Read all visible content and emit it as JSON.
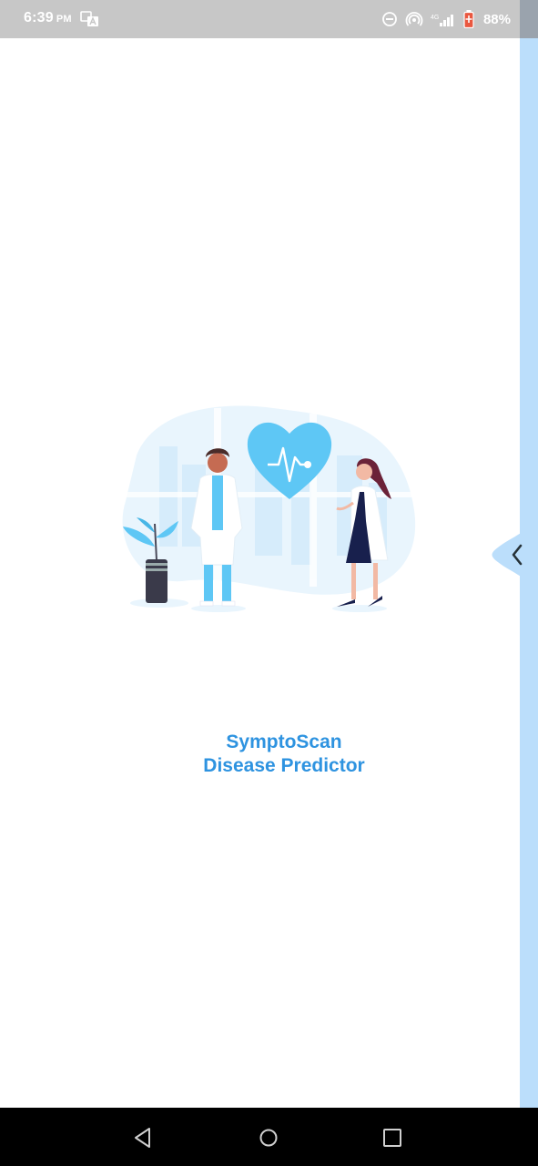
{
  "status_bar": {
    "time": "6:39",
    "ampm": "PM",
    "battery_percent": "88%",
    "icons": [
      "translate-icon",
      "do-not-disturb-icon",
      "hotspot-icon",
      "signal-icon",
      "battery-icon"
    ]
  },
  "app": {
    "title_line1": "SymptoScan",
    "title_line2": "Disease Predictor",
    "accent_color": "#2e93e0"
  },
  "edge_panel": {
    "color": "#bbdefb",
    "handle_icon": "chevron-left-icon"
  },
  "nav_bar": {
    "buttons": [
      "back-button",
      "home-button",
      "recents-button"
    ]
  }
}
